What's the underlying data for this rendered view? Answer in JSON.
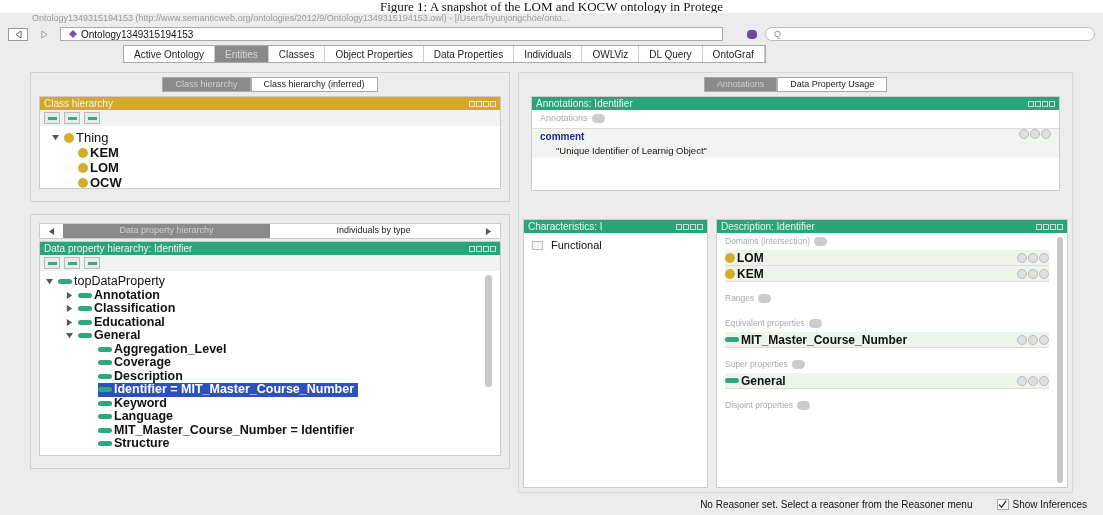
{
  "caption": "Figure 1: A snapshot of the LOM and KOCW ontology in Protege",
  "window": {
    "title": "Ontology1349315194153 (http://www.semanticweb.org/ontologies/2012/9/Ontology1349315194153.owl) - [/Users/hyunjongchoe/onto..."
  },
  "toolbar": {
    "ontology": "Ontology1349315194153",
    "search": {
      "placeholder": "Q"
    }
  },
  "tabs": [
    {
      "label": "Active Ontology",
      "selected": false
    },
    {
      "label": "Entities",
      "selected": true
    },
    {
      "label": "Classes",
      "selected": false
    },
    {
      "label": "Object Properties",
      "selected": false
    },
    {
      "label": "Data Properties",
      "selected": false
    },
    {
      "label": "Individuals",
      "selected": false
    },
    {
      "label": "OWLViz",
      "selected": false
    },
    {
      "label": "DL Query",
      "selected": false
    },
    {
      "label": "OntoGraf",
      "selected": false
    }
  ],
  "class_view": {
    "tabs": [
      {
        "label": "Class hierarchy",
        "selected": true
      },
      {
        "label": "Class hierarchy (inferred)",
        "selected": false
      }
    ],
    "header": "Class hierarchy",
    "tree": [
      {
        "label": "Thing",
        "expanded": true,
        "children": [
          {
            "label": "KEM"
          },
          {
            "label": "LOM"
          },
          {
            "label": "OCW"
          }
        ]
      }
    ]
  },
  "property_view": {
    "tabs": [
      {
        "label": "Data property hierarchy",
        "selected": true
      },
      {
        "label": "Individuals by type",
        "selected": false
      }
    ],
    "header": "Data property hierarchy: Identifier",
    "tree": [
      {
        "label": "topDataProperty",
        "expanded": true,
        "selected": false,
        "children": [
          {
            "label": "Annotation",
            "expanded": false,
            "selected": false
          },
          {
            "label": "Classification",
            "expanded": false,
            "selected": false
          },
          {
            "label": "Educational",
            "expanded": false,
            "selected": false
          },
          {
            "label": "General",
            "expanded": true,
            "selected": false,
            "children": [
              {
                "label": "Aggregation_Level",
                "selected": false
              },
              {
                "label": "Coverage",
                "selected": false
              },
              {
                "label": "Description",
                "selected": false
              },
              {
                "label": "Identifier = MIT_Master_Course_Number",
                "selected": true
              },
              {
                "label": "Keyword",
                "selected": false
              },
              {
                "label": "Language",
                "selected": false
              },
              {
                "label": "MIT_Master_Course_Number = Identifier",
                "selected": false
              },
              {
                "label": "Structure",
                "selected": false
              }
            ]
          }
        ]
      }
    ]
  },
  "annotation_view": {
    "tabs": [
      {
        "label": "Annotations",
        "selected": true
      },
      {
        "label": "Data Property Usage",
        "selected": false
      }
    ],
    "header": "Annotations: Identifier",
    "section": "Annotations",
    "items": [
      {
        "property": "comment",
        "value": "\"Unique Identifier of Learnig Object\""
      }
    ]
  },
  "characteristics": {
    "header": "Characteristics: I",
    "items": [
      {
        "label": "Functional",
        "checked": false
      }
    ]
  },
  "description": {
    "header": "Description: Identifier",
    "sections": [
      {
        "title": "Domains (intersection)",
        "items": [
          {
            "label": "LOM",
            "kind": "class"
          },
          {
            "label": "KEM",
            "kind": "class"
          }
        ]
      },
      {
        "title": "Ranges"
      },
      {
        "title": "Equivalent properties",
        "items": [
          {
            "label": "MIT_Master_Course_Number",
            "kind": "property"
          }
        ]
      },
      {
        "title": "Super properties",
        "items": [
          {
            "label": "General",
            "kind": "property"
          }
        ]
      },
      {
        "title": "Disjoint properties"
      }
    ]
  },
  "status_bar": {
    "message": "No Reasoner set. Select a reasoner from the Reasoner menu",
    "show_inferences": {
      "label": "Show Inferences",
      "checked": true
    }
  }
}
